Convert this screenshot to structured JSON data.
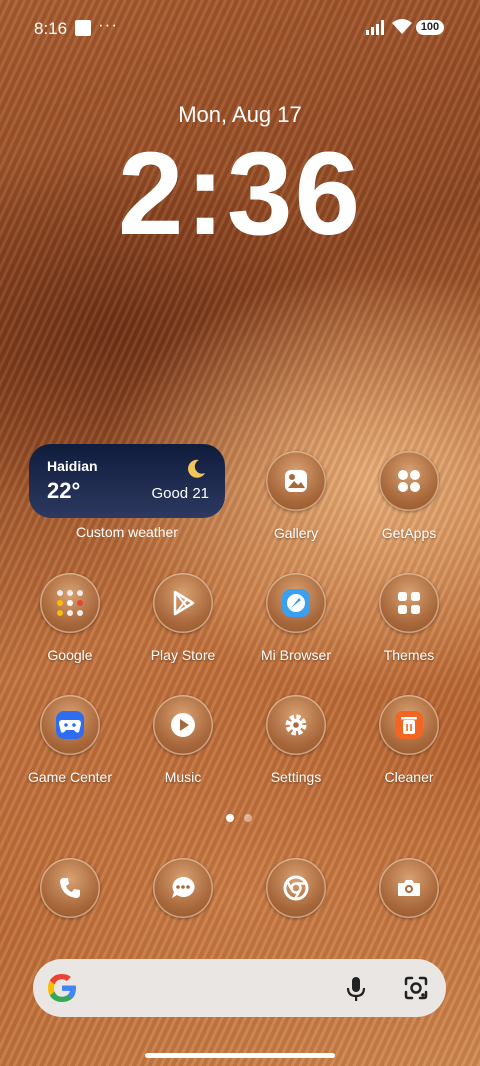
{
  "status_bar": {
    "time": "8:16",
    "more": "···",
    "battery": "100"
  },
  "lockscreen": {
    "date": "Mon, Aug 17",
    "time": "2:36"
  },
  "weather_widget": {
    "city": "Haidian",
    "temperature": "22°",
    "air_quality": "Good 21",
    "label": "Custom weather"
  },
  "apps": {
    "gallery": "Gallery",
    "getapps": "GetApps",
    "google": "Google",
    "play_store": "Play Store",
    "mi_browser": "Mi Browser",
    "themes": "Themes",
    "game_center": "Game Center",
    "music": "Music",
    "settings": "Settings",
    "cleaner": "Cleaner"
  },
  "pager": {
    "pages": 2,
    "current": 1
  },
  "colors": {
    "weather_bg": "#1a2748",
    "icon_bg": "#b27343",
    "search_bg": "#e9e6e4"
  }
}
